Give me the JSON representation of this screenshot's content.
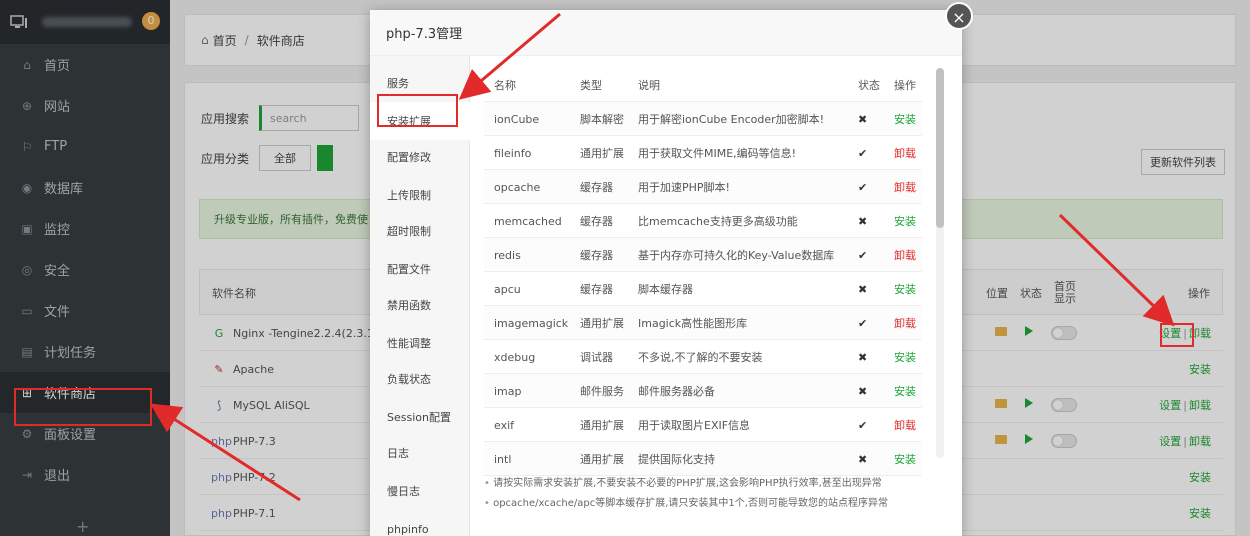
{
  "sidebar": {
    "badge": "0",
    "items": [
      {
        "label": "首页",
        "icon": "home-icon",
        "glyph": "⌂"
      },
      {
        "label": "网站",
        "icon": "globe-icon",
        "glyph": "⊕"
      },
      {
        "label": "FTP",
        "icon": "ftp-icon",
        "glyph": "⚐"
      },
      {
        "label": "数据库",
        "icon": "database-icon",
        "glyph": "◉"
      },
      {
        "label": "监控",
        "icon": "monitor-icon",
        "glyph": "▣"
      },
      {
        "label": "安全",
        "icon": "shield-icon",
        "glyph": "◎"
      },
      {
        "label": "文件",
        "icon": "folder-icon",
        "glyph": "▭"
      },
      {
        "label": "计划任务",
        "icon": "calendar-icon",
        "glyph": "▤"
      },
      {
        "label": "软件商店",
        "icon": "grid-icon",
        "glyph": "⊞",
        "active": true
      },
      {
        "label": "面板设置",
        "icon": "gear-icon",
        "glyph": "⚙"
      },
      {
        "label": "退出",
        "icon": "logout-icon",
        "glyph": "⇥"
      }
    ],
    "plus": "+"
  },
  "breadcrumb": {
    "home": "首页",
    "separator": "/",
    "current": "软件商店"
  },
  "store": {
    "search_label": "应用搜索",
    "search_placeholder": "search",
    "category_label": "应用分类",
    "category_all": "全部",
    "update_button": "更新软件列表",
    "promo": "升级专业版，所有插件，免费使",
    "headers": {
      "name": "软件名称",
      "location": "位置",
      "status": "状态",
      "homepage": "首页显示",
      "ops": "操作"
    },
    "rows": [
      {
        "name": "Nginx -Tengine2.2.4(2.3.1",
        "icon": "nginx-icon",
        "glyph": "G",
        "installed": true,
        "ops": [
          "设置",
          "卸载"
        ]
      },
      {
        "name": "Apache",
        "icon": "apache-icon",
        "glyph": "✎",
        "installed": false,
        "ops": [
          "安装"
        ]
      },
      {
        "name": "MySQL AliSQL",
        "icon": "mysql-icon",
        "glyph": "⟆",
        "installed": true,
        "ops": [
          "设置",
          "卸载"
        ]
      },
      {
        "name": "PHP-7.3",
        "icon": "php-icon",
        "glyph": "php",
        "installed": true,
        "ops": [
          "设置",
          "卸载"
        ]
      },
      {
        "name": "PHP-7.2",
        "icon": "php-icon",
        "glyph": "php",
        "installed": false,
        "ops": [
          "安装"
        ]
      },
      {
        "name": "PHP-7.1",
        "icon": "php-icon",
        "glyph": "php",
        "installed": false,
        "ops": [
          "安装"
        ]
      }
    ]
  },
  "modal": {
    "title": "php-7.3管理",
    "close": "×",
    "nav": [
      "服务",
      "安装扩展",
      "配置修改",
      "上传限制",
      "超时限制",
      "配置文件",
      "禁用函数",
      "性能调整",
      "负载状态",
      "Session配置",
      "日志",
      "慢日志",
      "phpinfo"
    ],
    "active_nav": 1,
    "table_headers": {
      "name": "名称",
      "type": "类型",
      "desc": "说明",
      "status": "状态",
      "op": "操作"
    },
    "extensions": [
      {
        "name": "ionCube",
        "type": "脚本解密",
        "desc": "用于解密ionCube Encoder加密脚本!",
        "status": "✖",
        "installed": false,
        "op": "安装"
      },
      {
        "name": "fileinfo",
        "type": "通用扩展",
        "desc": "用于获取文件MIME,编码等信息!",
        "status": "✔",
        "installed": true,
        "op": "卸载"
      },
      {
        "name": "opcache",
        "type": "缓存器",
        "desc": "用于加速PHP脚本!",
        "status": "✔",
        "installed": true,
        "op": "卸载"
      },
      {
        "name": "memcached",
        "type": "缓存器",
        "desc": "比memcache支持更多高级功能",
        "status": "✖",
        "installed": false,
        "op": "安装"
      },
      {
        "name": "redis",
        "type": "缓存器",
        "desc": "基于内存亦可持久化的Key-Value数据库",
        "status": "✔",
        "installed": true,
        "op": "卸载"
      },
      {
        "name": "apcu",
        "type": "缓存器",
        "desc": "脚本缓存器",
        "status": "✖",
        "installed": false,
        "op": "安装"
      },
      {
        "name": "imagemagick",
        "type": "通用扩展",
        "desc": "Imagick高性能图形库",
        "status": "✔",
        "installed": true,
        "op": "卸载"
      },
      {
        "name": "xdebug",
        "type": "调试器",
        "desc": "不多说,不了解的不要安装",
        "status": "✖",
        "installed": false,
        "op": "安装"
      },
      {
        "name": "imap",
        "type": "邮件服务",
        "desc": "邮件服务器必备",
        "status": "✖",
        "installed": false,
        "op": "安装"
      },
      {
        "name": "exif",
        "type": "通用扩展",
        "desc": "用于读取图片EXIF信息",
        "status": "✔",
        "installed": true,
        "op": "卸载"
      },
      {
        "name": "intl",
        "type": "通用扩展",
        "desc": "提供国际化支持",
        "status": "✖",
        "installed": false,
        "op": "安装"
      }
    ],
    "notes": [
      "请按实际需求安装扩展,不要安装不必要的PHP扩展,这会影响PHP执行效率,甚至出现异常",
      "opcache/xcache/apc等脚本缓存扩展,请只安装其中1个,否则可能导致您的站点程序异常"
    ]
  },
  "annotation_color": "#e12b2b",
  "accent_color": "#20a53a"
}
